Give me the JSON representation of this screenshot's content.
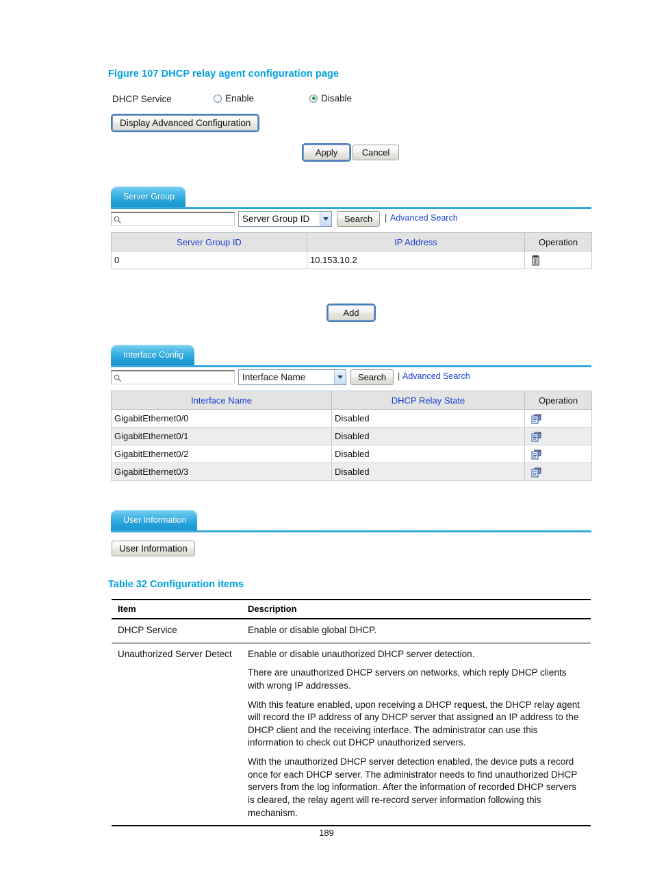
{
  "figure": {
    "caption": "Figure 107 DHCP relay agent configuration page"
  },
  "dhcp_service": {
    "label": "DHCP Service",
    "enable_label": "Enable",
    "disable_label": "Disable",
    "selected": "Disable",
    "advanced_button": "Display Advanced Configuration"
  },
  "form_buttons": {
    "apply": "Apply",
    "cancel": "Cancel",
    "add": "Add"
  },
  "server_group": {
    "tab_label": "Server Group",
    "search": {
      "value": "",
      "placeholder": "",
      "field_selected": "Server Group ID",
      "search_button": "Search",
      "separator": "|",
      "advanced_link": "Advanced Search",
      "magnifier_icon": "search-icon"
    },
    "columns": [
      "Server Group ID",
      "IP Address",
      "Operation"
    ],
    "rows": [
      {
        "server_group_id": "0",
        "ip_address": "10.153.10.2",
        "operation_icon": "trash-icon"
      }
    ]
  },
  "interface_config": {
    "tab_label": "Interface Config",
    "search": {
      "value": "",
      "placeholder": "",
      "field_selected": "Interface Name",
      "search_button": "Search",
      "separator": "|",
      "advanced_link": "Advanced Search",
      "magnifier_icon": "search-icon"
    },
    "columns": [
      "Interface Name",
      "DHCP Relay State",
      "Operation"
    ],
    "rows": [
      {
        "interface_name": "GigabitEthernet0/0",
        "relay_state": "Disabled",
        "operation_icon": "edit-icon"
      },
      {
        "interface_name": "GigabitEthernet0/1",
        "relay_state": "Disabled",
        "operation_icon": "edit-icon"
      },
      {
        "interface_name": "GigabitEthernet0/2",
        "relay_state": "Disabled",
        "operation_icon": "edit-icon"
      },
      {
        "interface_name": "GigabitEthernet0/3",
        "relay_state": "Disabled",
        "operation_icon": "edit-icon"
      }
    ]
  },
  "user_information": {
    "tab_label": "User Information",
    "button_label": "User Information"
  },
  "config_table": {
    "caption": "Table 32 Configuration items",
    "headers": [
      "Item",
      "Description"
    ],
    "rows": [
      {
        "item": "DHCP Service",
        "paragraphs": [
          "Enable or disable global DHCP."
        ]
      },
      {
        "item": "Unauthorized Server Detect",
        "paragraphs": [
          "Enable or disable unauthorized DHCP server detection.",
          "There are unauthorized DHCP servers on networks, which reply DHCP clients with wrong IP addresses.",
          "With this feature enabled, upon receiving a DHCP request, the DHCP relay agent will record the IP address of any DHCP server that assigned an IP address to the DHCP client and the receiving interface. The administrator can use this information to check out DHCP unauthorized servers.",
          "With the unauthorized DHCP server detection enabled, the device puts a record once for each DHCP server. The administrator needs to find unauthorized DHCP servers from the log information. After the information of recorded DHCP servers is cleared, the relay agent will re-record server information following this mechanism."
        ]
      }
    ]
  },
  "footer": {
    "page_number": "189"
  },
  "colors": {
    "accent_blue": "#00a0dd",
    "tab_blue": "#23a2da",
    "link_blue": "#1b3fd0",
    "header_link": "#1b3fd0",
    "radio_selected": "#1a9e3c"
  }
}
